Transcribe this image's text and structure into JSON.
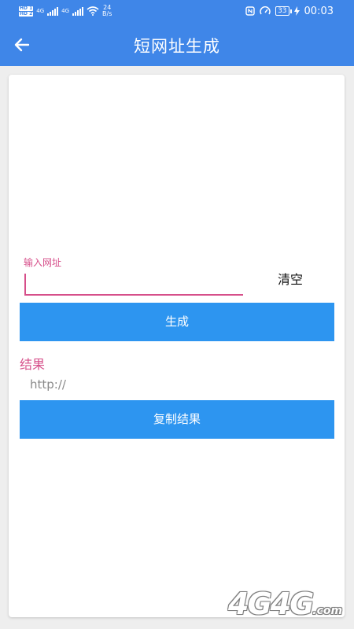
{
  "status_bar": {
    "hd_1": "HD 1",
    "hd_2": "HD 2",
    "net_1": "4G",
    "net_2": "4G",
    "speed_value": "24",
    "speed_unit": "B/s",
    "battery": "33",
    "time": "00:03"
  },
  "app_bar": {
    "title": "短网址生成",
    "back_icon": "arrow-left-icon"
  },
  "form": {
    "url_label": "输入网址",
    "url_value": "",
    "clear_label": "清空",
    "generate_label": "生成",
    "result_label": "结果",
    "result_value": "http://",
    "copy_label": "复制结果"
  },
  "watermark": {
    "text": "4G4G",
    "suffix": ".com"
  },
  "colors": {
    "primary": "#3f86e8",
    "button": "#2d95f0",
    "accent": "#d64f8a"
  }
}
